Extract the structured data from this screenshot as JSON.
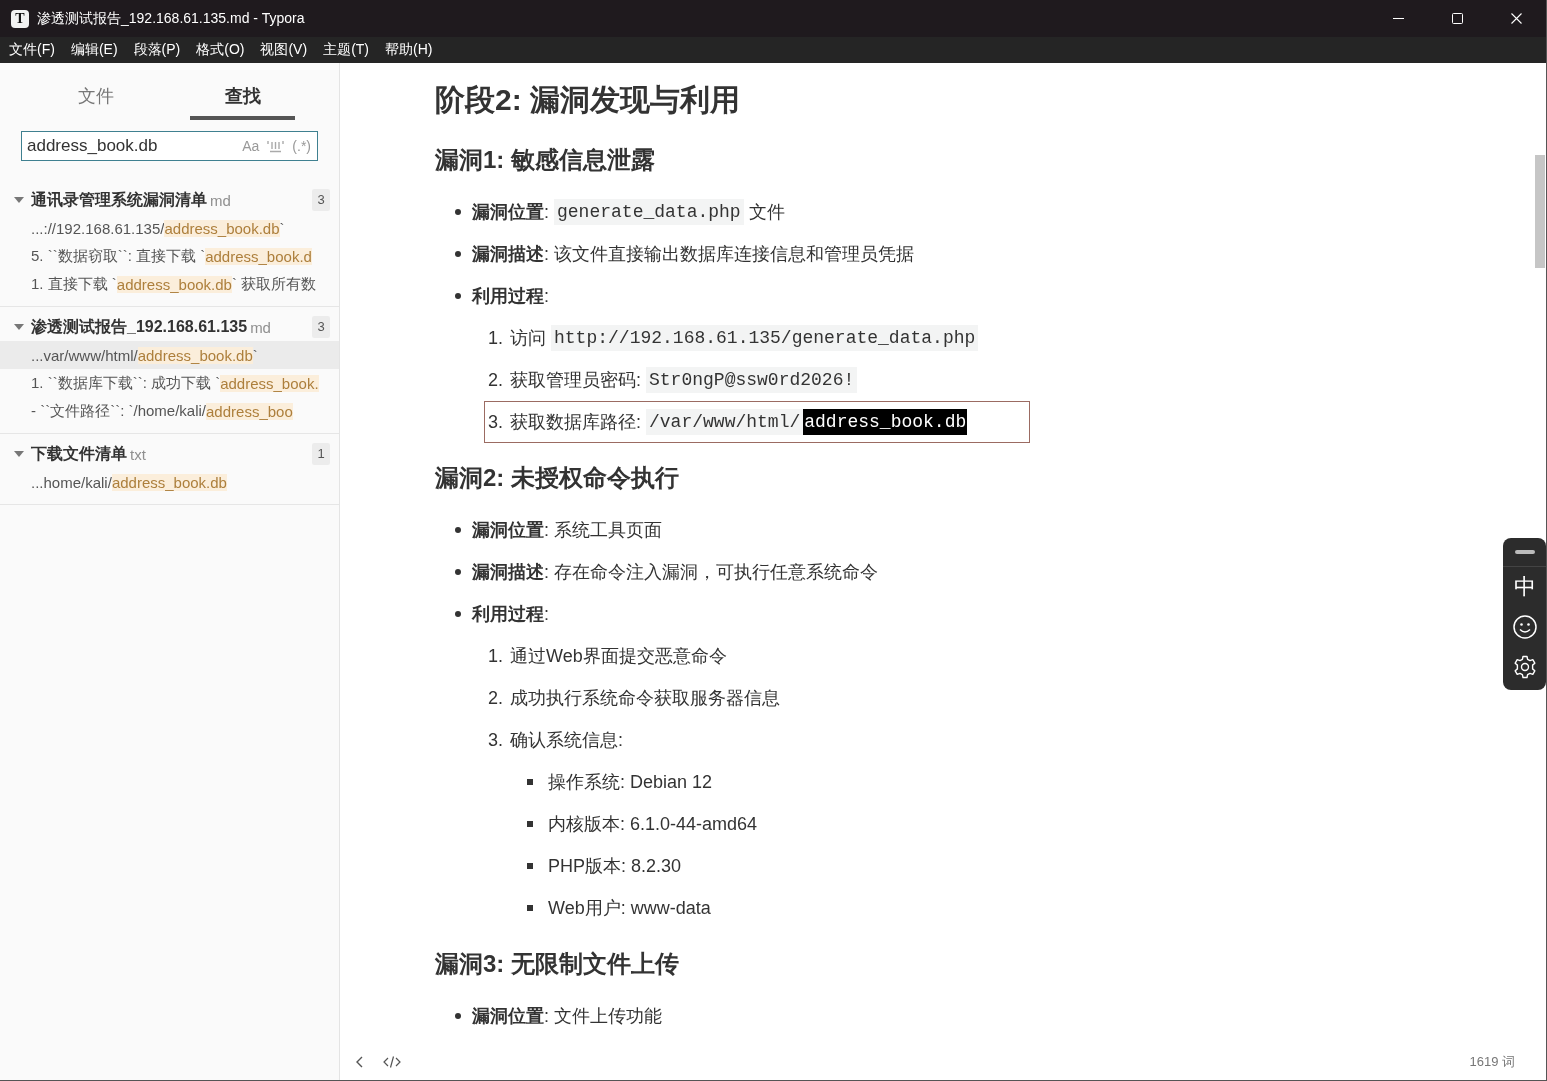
{
  "window": {
    "logo": "T",
    "title": "渗透测试报告_192.168.61.135.md - Typora"
  },
  "menu": [
    "文件(F)",
    "编辑(E)",
    "段落(P)",
    "格式(O)",
    "视图(V)",
    "主题(T)",
    "帮助(H)"
  ],
  "sidebar": {
    "tabs": [
      {
        "label": "文件",
        "selected": false
      },
      {
        "label": "查找",
        "selected": true
      }
    ],
    "search": {
      "value": "address_book.db",
      "options": [
        {
          "kind": "case",
          "label": "Aa"
        },
        {
          "kind": "whole_word"
        },
        {
          "kind": "regex",
          "label": "(.*)"
        }
      ]
    },
    "results": [
      {
        "name": "通讯录管理系统漏洞清单",
        "ext": "md",
        "count": "3",
        "expanded": true,
        "lines": [
          {
            "before": "...://192.168.61.135/",
            "match": "address_book.db",
            "after": "`",
            "selected": false
          },
          {
            "before": "5. ``数据窃取``: 直接下载 `",
            "match": "address_book.d",
            "selected": false
          },
          {
            "before": "1. 直接下载 `",
            "match": "address_book.db",
            "after": "` 获取所有数",
            "selected": false
          }
        ]
      },
      {
        "name": "渗透测试报告_192.168.61.135",
        "ext": "md",
        "count": "3",
        "expanded": true,
        "lines": [
          {
            "before": "...var/www/html/",
            "match": "address_book.db",
            "after": "`",
            "selected": true
          },
          {
            "before": "1. ``数据库下载``: 成功下载 `",
            "match": "address_book.",
            "selected": false
          },
          {
            "before": "- ``文件路径``: `/home/kali/",
            "match": "address_boo",
            "selected": false
          }
        ]
      },
      {
        "name": "下载文件清单",
        "ext": "txt",
        "count": "1",
        "expanded": true,
        "lines": [
          {
            "before": "...home/kali/",
            "match": "address_book.db",
            "selected": false
          }
        ]
      }
    ]
  },
  "document": {
    "blocks": [
      {
        "kind": "h1",
        "text": "阶段2: 漏洞发现与利用"
      },
      {
        "kind": "h2",
        "text": "漏洞1: 敏感信息泄露"
      },
      {
        "kind": "bullets",
        "items": [
          {
            "runs": [
              {
                "kind": "text",
                "text": "**漏洞位置**: "
              },
              {
                "kind": "code",
                "text": "generate_data.php"
              },
              {
                "kind": "text",
                "text": " 文件"
              }
            ]
          },
          {
            "runs": [
              {
                "kind": "text",
                "text": "**漏洞描述**: 该文件直接输出数据库连接信息和管理员凭据"
              }
            ]
          },
          {
            "runs": [
              {
                "kind": "text",
                "text": "**利用过程**:"
              }
            ],
            "children": {
              "kind": "numbered",
              "items": [
                {
                  "number": "1.",
                  "focused": false,
                  "runs": [
                    {
                      "kind": "text",
                      "text": "访问 "
                    },
                    {
                      "kind": "code",
                      "text": "http://192.168.61.135/generate_data.php"
                    }
                  ]
                },
                {
                  "number": "2.",
                  "focused": false,
                  "runs": [
                    {
                      "kind": "text",
                      "text": "获取管理员密码: "
                    },
                    {
                      "kind": "code",
                      "text": "Str0ngP@ssw0rd2026!"
                    }
                  ]
                },
                {
                  "number": "3.",
                  "focused": true,
                  "runs": [
                    {
                      "kind": "text",
                      "text": "获取数据库路径: "
                    },
                    {
                      "kind": "code",
                      "text": "/var/www/html/"
                    },
                    {
                      "kind": "match",
                      "text": "address_book.db"
                    }
                  ]
                }
              ]
            }
          }
        ]
      },
      {
        "kind": "h2",
        "text": "漏洞2: 未授权命令执行"
      },
      {
        "kind": "bullets",
        "items": [
          {
            "runs": [
              {
                "kind": "text",
                "text": "**漏洞位置**: 系统工具页面"
              }
            ]
          },
          {
            "runs": [
              {
                "kind": "text",
                "text": "**漏洞描述**: 存在命令注入漏洞，可执行任意系统命令"
              }
            ]
          },
          {
            "runs": [
              {
                "kind": "text",
                "text": "**利用过程**:"
              }
            ],
            "children": {
              "kind": "numbered",
              "items": [
                {
                  "number": "1.",
                  "focused": false,
                  "runs": [
                    {
                      "kind": "text",
                      "text": "通过Web界面提交恶意命令"
                    }
                  ]
                },
                {
                  "number": "2.",
                  "focused": false,
                  "runs": [
                    {
                      "kind": "text",
                      "text": "成功执行系统命令获取服务器信息"
                    }
                  ]
                },
                {
                  "number": "3.",
                  "focused": false,
                  "runs": [
                    {
                      "kind": "text",
                      "text": "确认系统信息:"
                    }
                  ],
                  "children": {
                    "kind": "squares",
                    "items": [
                      {
                        "runs": [
                          {
                            "kind": "text",
                            "text": "操作系统: Debian 12"
                          }
                        ]
                      },
                      {
                        "runs": [
                          {
                            "kind": "text",
                            "text": "内核版本: 6.1.0-44-amd64"
                          }
                        ]
                      },
                      {
                        "runs": [
                          {
                            "kind": "text",
                            "text": "PHP版本: 8.2.30"
                          }
                        ]
                      },
                      {
                        "runs": [
                          {
                            "kind": "text",
                            "text": "Web用户: www-data"
                          }
                        ]
                      }
                    ]
                  }
                }
              ]
            }
          }
        ]
      },
      {
        "kind": "h2",
        "text": "漏洞3: 无限制文件上传"
      },
      {
        "kind": "bullets",
        "items": [
          {
            "runs": [
              {
                "kind": "text",
                "text": "**漏洞位置**: 文件上传功能"
              }
            ]
          }
        ]
      }
    ]
  },
  "status_bar": {
    "word_count": "1619 词"
  },
  "ime_toolbar": {
    "mode": "中"
  }
}
